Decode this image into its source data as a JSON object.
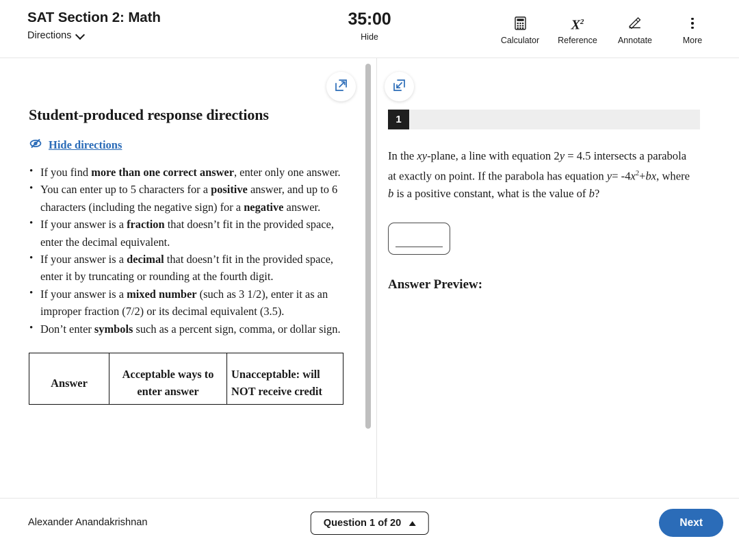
{
  "header": {
    "exam_title": "SAT Section 2: Math",
    "directions_label": "Directions",
    "timer_value": "35:00",
    "timer_hide_label": "Hide",
    "tools": [
      {
        "label": "Calculator",
        "icon": "calculator-icon"
      },
      {
        "label": "Reference",
        "icon": "x-squared-icon"
      },
      {
        "label": "Annotate",
        "icon": "pencil-icon"
      },
      {
        "label": "More",
        "icon": "more-vertical-icon"
      }
    ]
  },
  "directions_panel": {
    "title": "Student-produced response directions",
    "hide_link_label": "Hide directions",
    "bullets": [
      {
        "prefix": "If you find ",
        "bold": "more than one correct answer",
        "suffix": ", enter only one answer."
      },
      {
        "prefix": "You can enter up to 5 characters for a ",
        "bold": "positive",
        "suffix": " answer, and up to 6 characters (including the negative sign) for a ",
        "bold2": "negative",
        "suffix2": " answer."
      },
      {
        "prefix": " If your answer is a ",
        "bold": "fraction",
        "suffix": " that doesn’t fit in the provided space, enter the decimal equivalent."
      },
      {
        "prefix": " If your answer is a ",
        "bold": "decimal",
        "suffix": " that doesn’t fit in the provided space, enter it by truncating or rounding at the fourth digit."
      },
      {
        "prefix": " If your answer is a ",
        "bold": "mixed number",
        "suffix": " (such as 3 1/2), enter it as an improper fraction (7/2) or its decimal equivalent (3.5)."
      },
      {
        "prefix": "Don’t enter ",
        "bold": "symbols",
        "suffix": " such as a percent sign, comma, or dollar sign."
      }
    ],
    "table_headers": [
      "Answer",
      "Acceptable ways to enter answer",
      "Unacceptable: will NOT receive credit"
    ]
  },
  "question_panel": {
    "number": "1",
    "text_parts": {
      "p1": "In the ",
      "xy": "xy",
      "p2": "-plane, a line with equation 2",
      "y1": "y",
      "p3": " = 4.5 intersects a parabola at exactly on point. If the parabola has equation ",
      "y2": "y",
      "p4": "= -4",
      "x1": "x",
      "sup": "2",
      "p5": "+",
      "b1": "bx",
      "p6": ", where ",
      "b2": "b",
      "p7": " is a positive constant, what is the value of ",
      "b3": "b",
      "p8": "?"
    },
    "answer_value": "",
    "answer_preview_label": "Answer Preview:"
  },
  "footer": {
    "student_name": "Alexander Anandakrishnan",
    "question_nav_label": "Question 1 of 20",
    "next_label": "Next"
  },
  "colors": {
    "accent_blue": "#2b6cb8",
    "badge_dark": "#1f1f1f",
    "numbar_grey": "#eeeeee"
  }
}
